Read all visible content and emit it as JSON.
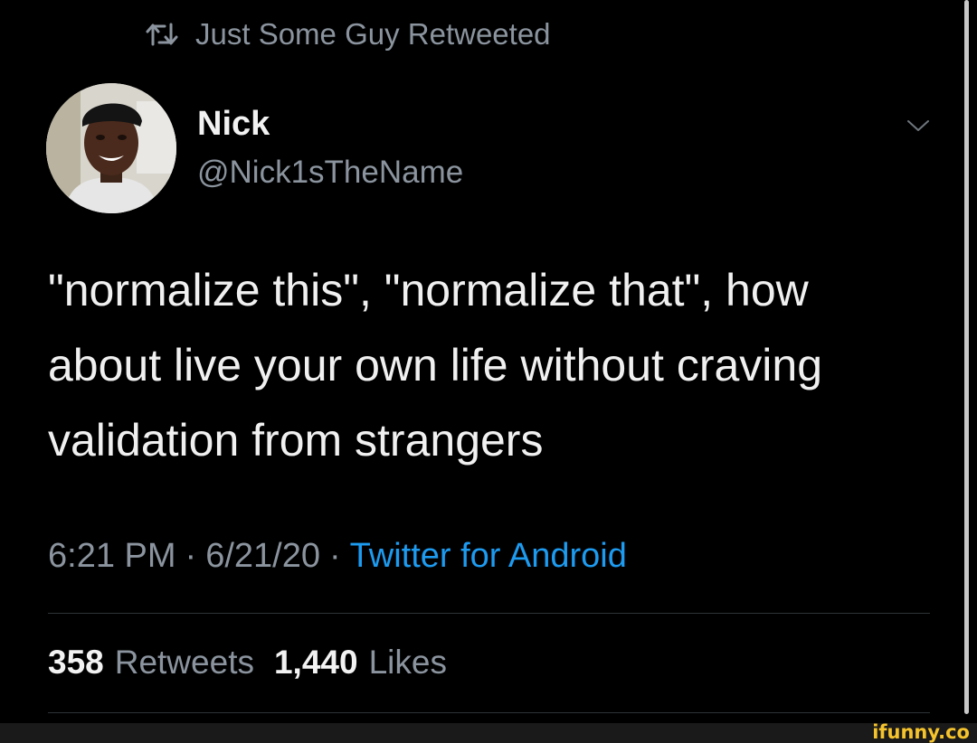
{
  "retweet": {
    "icon": "retweet-icon",
    "text": "Just Some Guy Retweeted"
  },
  "author": {
    "avatar": "avatar-photo",
    "display_name": "Nick",
    "handle": "@Nick1sTheName"
  },
  "menu": {
    "icon": "chevron-down-icon"
  },
  "tweet": {
    "lines": [
      "\"normalize this\", \"normalize that\", how",
      "about live your own life without craving",
      "validation from strangers"
    ]
  },
  "meta": {
    "time": "6:21 PM",
    "separator": "·",
    "date": "6/21/20",
    "source": "Twitter for Android"
  },
  "stats": {
    "retweets_count": "358",
    "retweets_label": "Retweets",
    "likes_count": "1,440",
    "likes_label": "Likes"
  },
  "watermark": {
    "text": "ifunny.co"
  },
  "colors": {
    "background": "#000000",
    "secondary_text": "#8b949e",
    "link": "#1d9bf0",
    "divider": "#2f3336",
    "watermark": "#f5c32c"
  }
}
